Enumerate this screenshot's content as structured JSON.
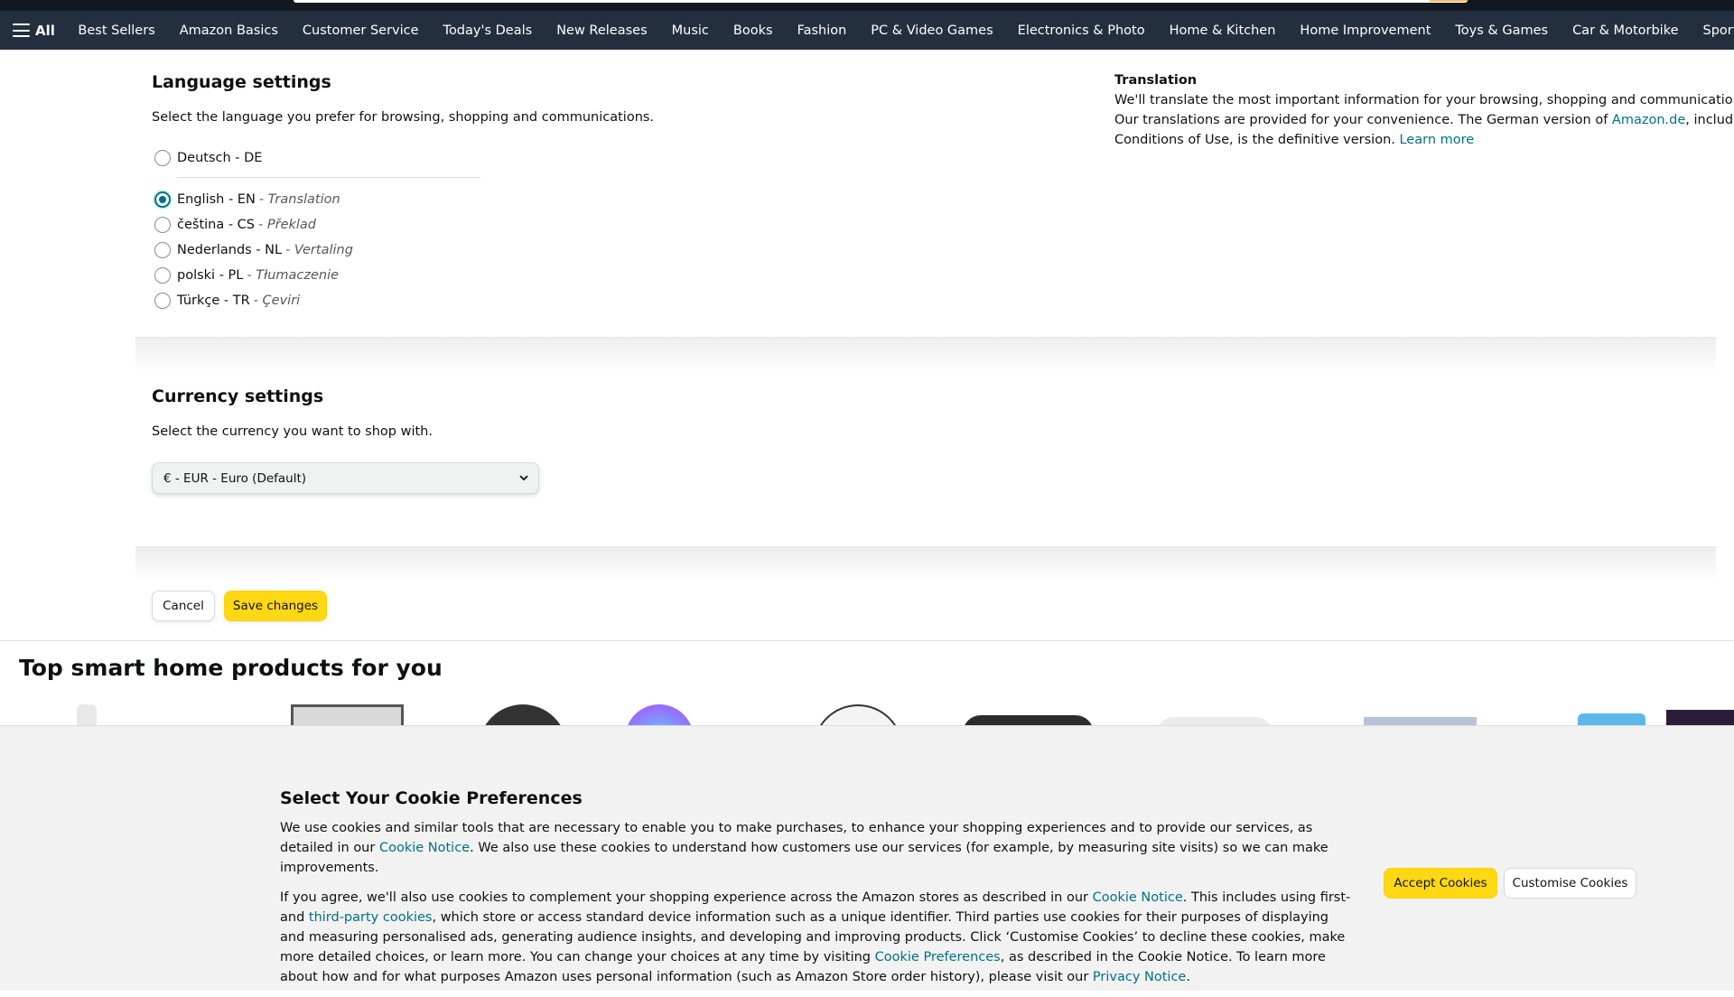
{
  "nav": {
    "all_label": "All",
    "items": [
      "Best Sellers",
      "Amazon Basics",
      "Customer Service",
      "Today's Deals",
      "New Releases",
      "Music",
      "Books",
      "Fashion",
      "PC & Video Games",
      "Electronics & Photo",
      "Home & Kitchen",
      "Home Improvement",
      "Toys & Games",
      "Car & Motorbike",
      "Sports & O"
    ]
  },
  "language": {
    "title": "Language settings",
    "description": "Select the language you prefer for browsing, shopping and communications.",
    "options": [
      {
        "label": "Deutsch - DE",
        "sub": "",
        "selected": false
      },
      {
        "label": "English - EN",
        "sub": "- Translation",
        "selected": true
      },
      {
        "label": "čeština - CS",
        "sub": "- Překlad",
        "selected": false
      },
      {
        "label": "Nederlands - NL",
        "sub": "- Vertaling",
        "selected": false
      },
      {
        "label": "polski - PL",
        "sub": "- Tłumaczenie",
        "selected": false
      },
      {
        "label": "Türkçe - TR",
        "sub": "- Çeviri",
        "selected": false
      }
    ]
  },
  "translation": {
    "title": "Translation",
    "line1": "We'll translate the most important information for your browsing, shopping and communications",
    "line2_a": "Our translations are provided for your convenience. The German version of ",
    "line2_link": "Amazon.de",
    "line2_b": ", including",
    "line3": "Conditions of Use, is the definitive version. ",
    "learn_more": "Learn more"
  },
  "currency": {
    "title": "Currency settings",
    "description": "Select the currency you want to shop with.",
    "selected": "€ - EUR - Euro (Default)"
  },
  "actions": {
    "cancel": "Cancel",
    "save": "Save changes"
  },
  "shelf": {
    "title": "Top smart home products for you"
  },
  "cookie": {
    "title": "Select Your Cookie Preferences",
    "p1_a": "We use cookies and similar tools that are necessary to enable you to make purchases, to enhance your shopping experiences and to provide our services, as detailed in our ",
    "p1_link": "Cookie Notice",
    "p1_b": ". We also use these cookies to understand how customers use our services (for example, by measuring site visits) so we can make improvements.",
    "p2_a": "If you agree, we'll also use cookies to complement your shopping experience across the Amazon stores as described in our ",
    "p2_link1": "Cookie Notice",
    "p2_b": ". This includes using first- and ",
    "p2_link2": "third-party cookies",
    "p2_c": ", which store or access standard device information such as a unique identifier. Third parties use cookies for their purposes of displaying and measuring personalised ads, generating audience insights, and developing and improving products. Click ‘Customise Cookies’ to decline these cookies, make more detailed choices, or learn more. You can change your choices at any time by visiting ",
    "p2_link3": "Cookie Preferences",
    "p2_d": ", as described in the Cookie Notice. To learn more about how and for what purposes Amazon uses personal information (such as Amazon Store order history), please visit our ",
    "p2_link4": "Privacy Notice",
    "p2_e": ".",
    "accept": "Accept Cookies",
    "customise": "Customise Cookies"
  }
}
